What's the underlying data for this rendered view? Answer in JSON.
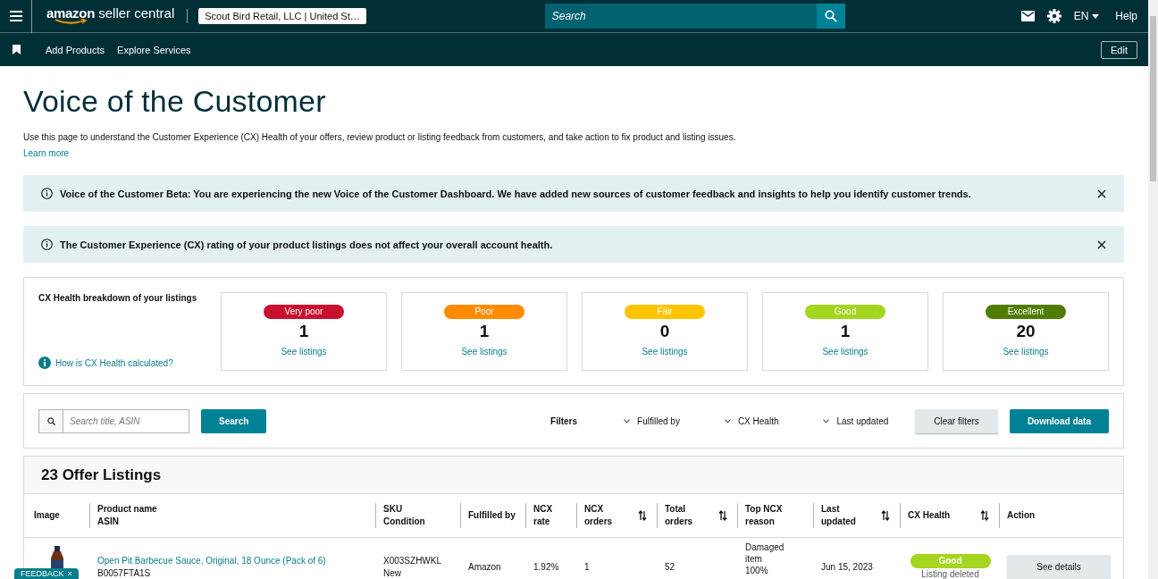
{
  "topbar": {
    "logo_brand": "amazon",
    "logo_product": "seller central",
    "account": "Scout Bird Retail, LLC | United St…",
    "search_placeholder": "Search",
    "language": "EN",
    "help": "Help"
  },
  "navbar": {
    "links": [
      "Add Products",
      "Explore Services"
    ],
    "edit": "Edit"
  },
  "page": {
    "title": "Voice of the Customer",
    "description": "Use this page to understand the Customer Experience (CX) Health of your offers, review product or listing feedback from customers, and take action to fix product and listing issues.",
    "learn_more": "Learn more"
  },
  "banners": [
    {
      "text": "Voice of the Customer Beta: You are experiencing the new Voice of the Customer Dashboard. We have added new sources of customer feedback and insights to help you identify customer trends."
    },
    {
      "text": "The Customer Experience (CX) rating of your product listings does not affect your overall account health."
    }
  ],
  "health": {
    "title": "CX Health breakdown of your listings",
    "link": "How is CX Health calculated?",
    "tiles": [
      {
        "label": "Very poor",
        "color": "#c8102e",
        "count": "1",
        "link": "See listings"
      },
      {
        "label": "Poor",
        "color": "#ff8c00",
        "count": "1",
        "link": "See listings"
      },
      {
        "label": "Fair",
        "color": "#ffc400",
        "count": "0",
        "link": "See listings"
      },
      {
        "label": "Good",
        "color": "#a4d51f",
        "count": "1",
        "link": "See listings"
      },
      {
        "label": "Excellent",
        "color": "#507c00",
        "count": "20",
        "link": "See listings"
      }
    ]
  },
  "filters": {
    "search_placeholder": "Search title, ASIN",
    "search_button": "Search",
    "label": "Filters",
    "dropdowns": [
      "Fulfilled by",
      "CX Health",
      "Last updated"
    ],
    "clear": "Clear filters",
    "download": "Download data"
  },
  "listings": {
    "title": "23 Offer Listings",
    "columns": [
      {
        "lines": [
          "Image"
        ],
        "sortable": false
      },
      {
        "lines": [
          "Product name",
          "ASIN"
        ],
        "sortable": false
      },
      {
        "lines": [
          "SKU",
          "Condition"
        ],
        "sortable": false
      },
      {
        "lines": [
          "Fulfilled by"
        ],
        "sortable": false
      },
      {
        "lines": [
          "NCX rate"
        ],
        "sortable": false
      },
      {
        "lines": [
          "NCX",
          "orders"
        ],
        "sortable": true
      },
      {
        "lines": [
          "Total",
          "orders"
        ],
        "sortable": true
      },
      {
        "lines": [
          "Top NCX",
          "reason"
        ],
        "sortable": false
      },
      {
        "lines": [
          "Last",
          "updated"
        ],
        "sortable": true
      },
      {
        "lines": [
          "CX Health"
        ],
        "sortable": true
      },
      {
        "lines": [
          "Action"
        ],
        "sortable": false
      }
    ],
    "rows": [
      {
        "product_name": "Open Pit Barbecue Sauce, Original, 18 Ounce (Pack of 6)",
        "asin": "B0057FTA1S",
        "sku": "X003SZHWKL",
        "condition": "New",
        "fulfilled_by": "Amazon",
        "ncx_rate": "1.92%",
        "ncx_orders": "1",
        "total_orders": "52",
        "top_reason": "Damaged item",
        "reason_share": "100%",
        "last_updated": "Jun 15, 2023",
        "health": {
          "label": "Good",
          "color": "#a4d51f"
        },
        "status": "Listing deleted",
        "action": "See details"
      }
    ]
  },
  "feedback": {
    "label": "FEEDBACK",
    "close": "×"
  }
}
